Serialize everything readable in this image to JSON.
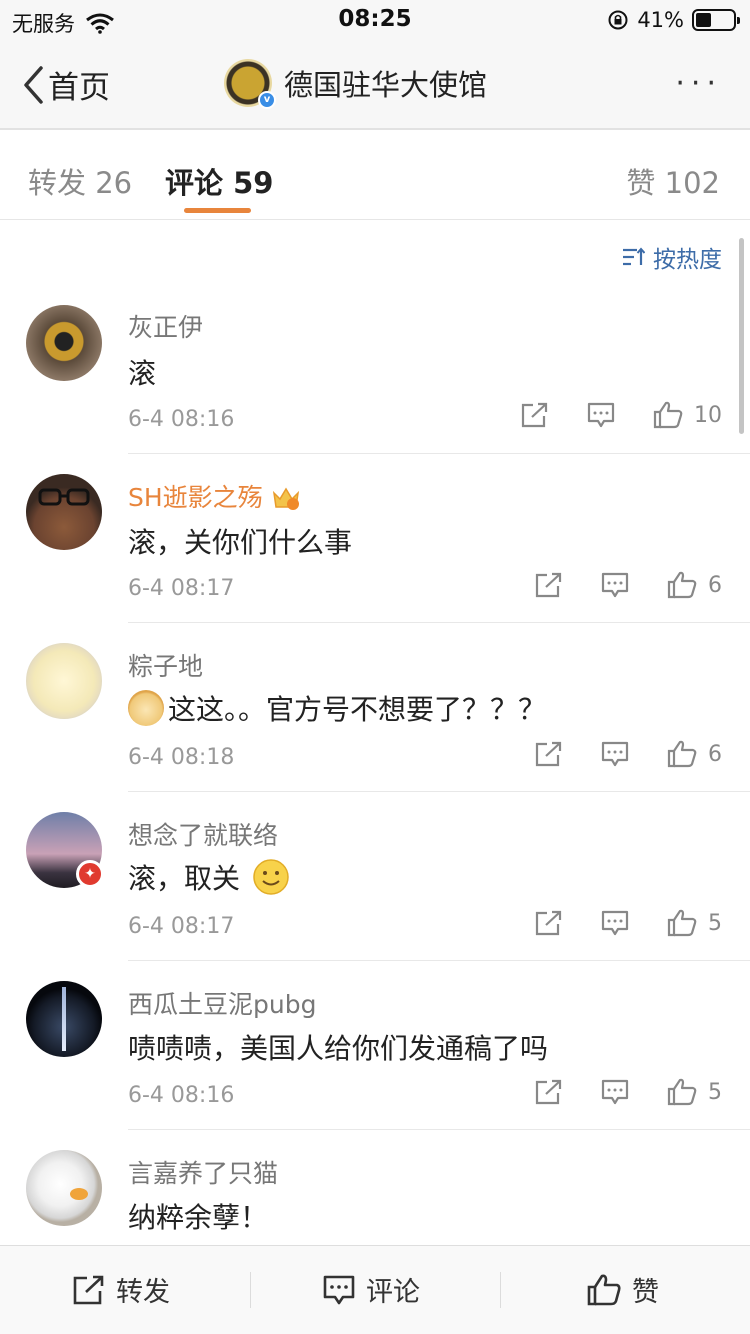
{
  "status_bar": {
    "carrier": "无服务",
    "time": "08:25",
    "battery_percent": "41%",
    "battery_level": 0.41
  },
  "nav": {
    "back_label": "首页",
    "title": "德国驻华大使馆",
    "more_label": "···"
  },
  "tabs": {
    "repost": "转发 26",
    "comments": "评论 59",
    "likes": "赞 102"
  },
  "sort_label": "按热度",
  "comments": [
    {
      "name": "灰正伊",
      "text": "滚",
      "time": "6-4 08:16",
      "likes": "10"
    },
    {
      "name": "SH逝影之殇",
      "text": "滚，关你们什么事",
      "time": "6-4 08:17",
      "likes": "6"
    },
    {
      "name": "粽子地",
      "text": "这这。。官方号不想要了？？？",
      "time": "6-4 08:18",
      "likes": "6"
    },
    {
      "name": "想念了就联络",
      "text": "滚，取关",
      "time": "6-4 08:17",
      "likes": "5"
    },
    {
      "name": "西瓜土豆泥pubg",
      "text": "啧啧啧，美国人给你们发通稿了吗",
      "time": "6-4 08:16",
      "likes": "5"
    },
    {
      "name": "言嘉养了只猫",
      "text": "纳粹余孽！",
      "time": "",
      "likes": ""
    }
  ],
  "bottom_bar": {
    "repost": "转发",
    "comment": "评论",
    "like": "赞"
  },
  "colors": {
    "accent": "#e8853c",
    "link": "#3d6ca8",
    "vip_name": "#e8853c"
  }
}
